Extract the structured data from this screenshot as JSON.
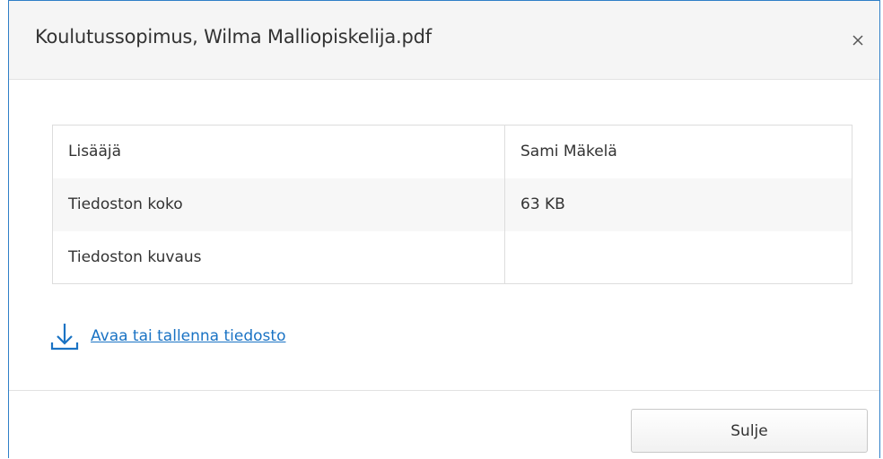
{
  "dialog": {
    "title": "Koulutussopimus, Wilma Malliopiskelija.pdf",
    "close_icon": "close-icon"
  },
  "details": {
    "rows": [
      {
        "label": "Lisääjä",
        "value": "Sami Mäkelä"
      },
      {
        "label": "Tiedoston koko",
        "value": "63 KB"
      },
      {
        "label": "Tiedoston kuvaus",
        "value": ""
      }
    ]
  },
  "download": {
    "icon": "download-icon",
    "link_text": "Avaa tai tallenna tiedosto"
  },
  "footer": {
    "close_label": "Sulje"
  },
  "colors": {
    "accent": "#1a73c4",
    "dialog_border": "#2f7fc7",
    "header_bg": "#f5f5f5"
  }
}
